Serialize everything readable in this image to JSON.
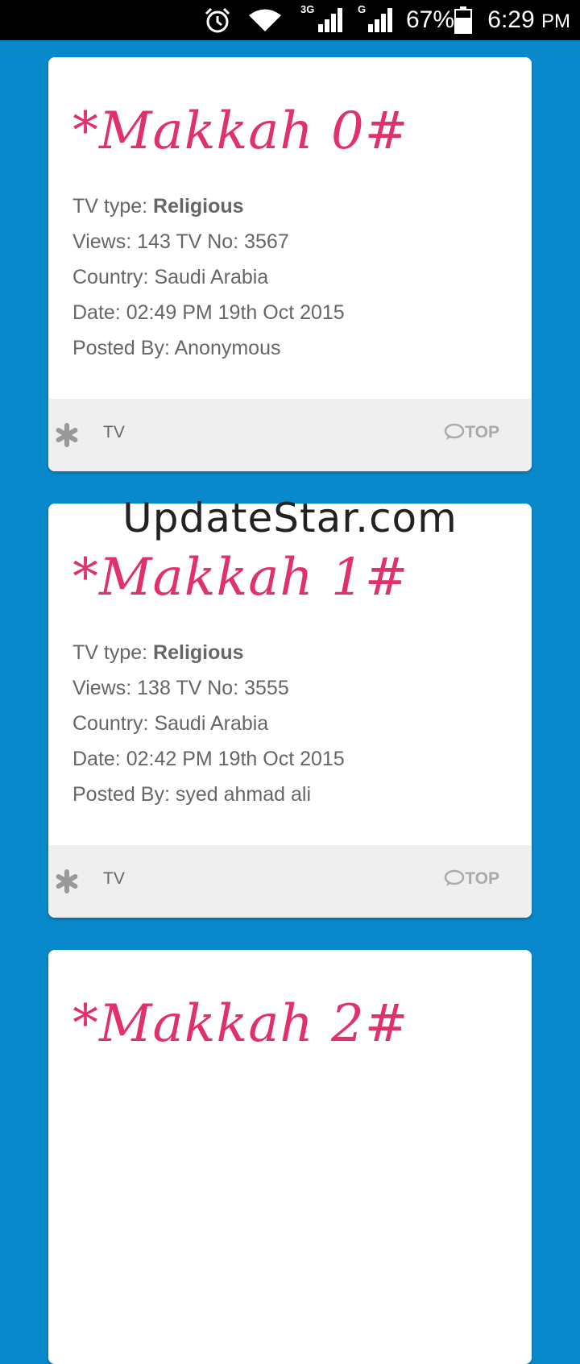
{
  "status_bar": {
    "network_1": "3G",
    "network_2": "G",
    "battery_percent": "67%",
    "time": "6:29",
    "ampm": "PM"
  },
  "watermark": "UpdateStar.com",
  "labels": {
    "tv_type": "TV type: ",
    "views": "Views: ",
    "tv_no": "TV No: ",
    "country": "Country: ",
    "date": "Date: ",
    "posted_by": "Posted By: "
  },
  "cards": [
    {
      "title": "*Makkah 0#",
      "tv_type": "Religious",
      "views": "143",
      "tv_no": "3567",
      "country": "Saudi Arabia",
      "date": "02:49 PM 19th Oct 2015",
      "posted_by": "Anonymous",
      "category": "TV",
      "top_label": "TOP"
    },
    {
      "title": "*Makkah 1#",
      "tv_type": "Religious",
      "views": "138",
      "tv_no": "3555",
      "country": "Saudi Arabia",
      "date": "02:42 PM 19th Oct 2015",
      "posted_by": "syed ahmad ali",
      "category": "TV",
      "top_label": "TOP"
    },
    {
      "title": "*Makkah 2#"
    }
  ],
  "colors": {
    "background": "#0a88cc",
    "title": "#e0306e",
    "card": "#ffffff",
    "footer": "#efefef"
  }
}
